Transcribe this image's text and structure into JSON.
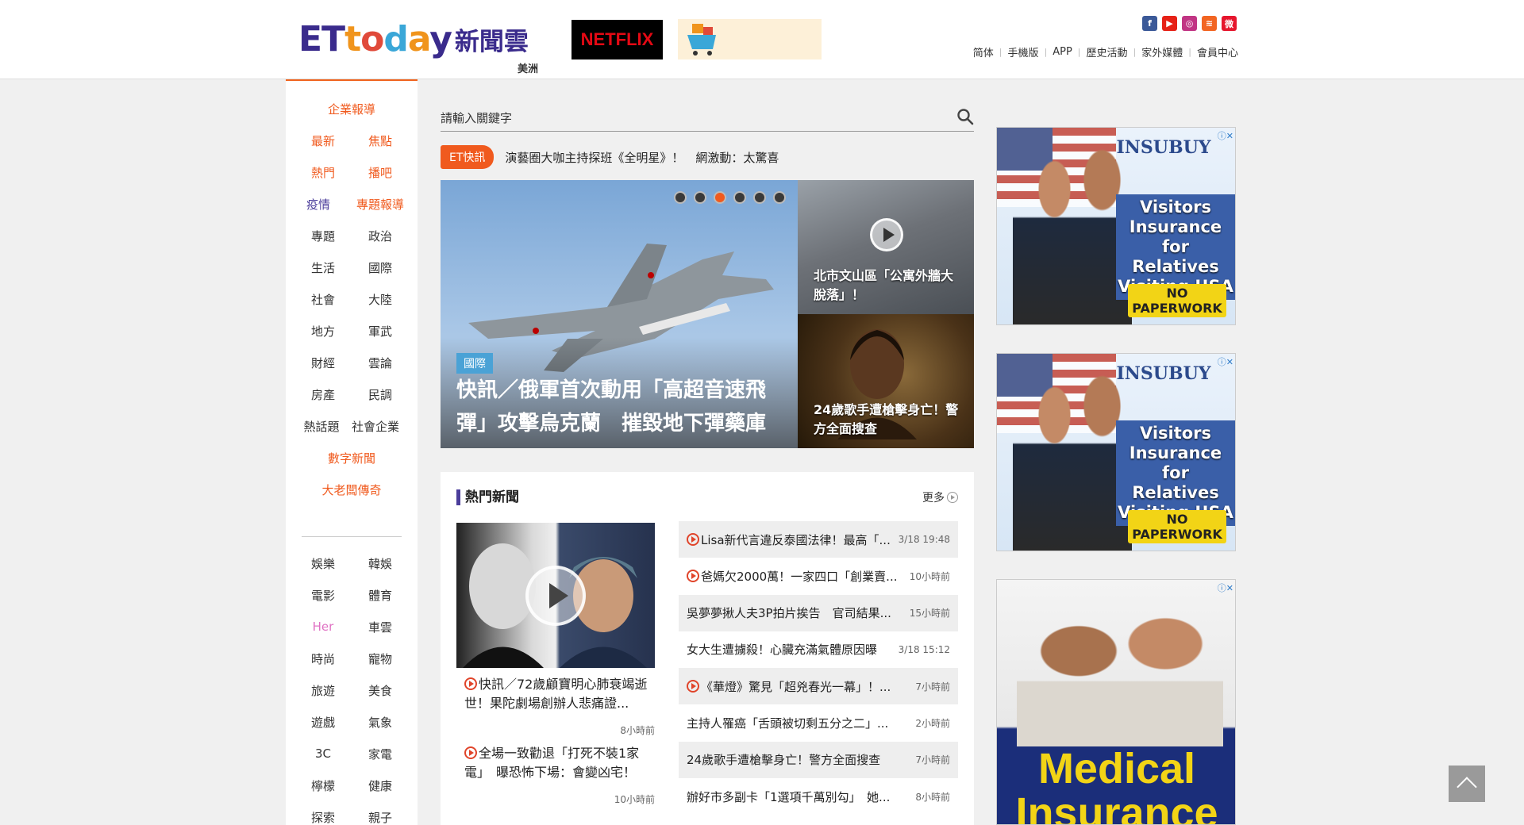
{
  "header": {
    "logo_et": [
      "ET",
      "t",
      "o",
      "d",
      "a",
      "y"
    ],
    "logo_cn": "新聞雲",
    "region": "美洲",
    "netflix_label": "NETFLIX",
    "topnav": [
      "简体",
      "手機版",
      "APP",
      "歷史活動",
      "家外媒體",
      "會員中心"
    ],
    "social_icons": [
      {
        "name": "facebook-icon",
        "glyph": "f",
        "color": "#3b5998"
      },
      {
        "name": "youtube-icon",
        "glyph": "▶",
        "color": "#e62117"
      },
      {
        "name": "instagram-icon",
        "glyph": "◎",
        "color": "#c13584"
      },
      {
        "name": "rss-icon",
        "glyph": "≋",
        "color": "#f26522"
      },
      {
        "name": "weibo-icon",
        "glyph": "微",
        "color": "#e6162d"
      }
    ]
  },
  "leftnav": {
    "rows": [
      {
        "items": [
          "企業報導"
        ],
        "style": "orange"
      },
      {
        "items": [
          "最新",
          "焦點"
        ],
        "style": "orange"
      },
      {
        "items": [
          "熱門",
          "播吧"
        ],
        "style": "orange"
      },
      {
        "items": [
          "疫情",
          "專題報導"
        ],
        "style": "purple-orange"
      },
      {
        "items": [
          "專題",
          "政治"
        ],
        "style": "plain"
      },
      {
        "items": [
          "生活",
          "國際"
        ],
        "style": "plain"
      },
      {
        "items": [
          "社會",
          "大陸"
        ],
        "style": "plain"
      },
      {
        "items": [
          "地方",
          "軍武"
        ],
        "style": "plain"
      },
      {
        "items": [
          "財經",
          "雲論"
        ],
        "style": "plain"
      },
      {
        "items": [
          "房產",
          "民調"
        ],
        "style": "plain"
      },
      {
        "items": [
          "熱話題",
          "社會企業"
        ],
        "style": "plain"
      },
      {
        "items": [
          "數字新聞"
        ],
        "style": "orange"
      },
      {
        "items": [
          "大老闆傳奇"
        ],
        "style": "orange"
      }
    ],
    "rows2": [
      {
        "items": [
          "娛樂",
          "韓娛"
        ],
        "style": "plain"
      },
      {
        "items": [
          "電影",
          "體育"
        ],
        "style": "plain"
      },
      {
        "items": [
          "Her",
          "車雲"
        ],
        "style": "pink-plain"
      },
      {
        "items": [
          "時尚",
          "寵物"
        ],
        "style": "plain"
      },
      {
        "items": [
          "旅遊",
          "美食"
        ],
        "style": "plain"
      },
      {
        "items": [
          "遊戲",
          "氣象"
        ],
        "style": "plain"
      },
      {
        "items": [
          "3C",
          "家電"
        ],
        "style": "plain"
      },
      {
        "items": [
          "檸檬",
          "健康"
        ],
        "style": "plain"
      },
      {
        "items": [
          "探索",
          "親子"
        ],
        "style": "plain"
      }
    ]
  },
  "search": {
    "placeholder": "請輸入關鍵字"
  },
  "ticker": {
    "tag": "ET快訊",
    "text": "演藝圈大咖主持探班《全明星》！　網激動：太驚喜"
  },
  "hero": {
    "category": "國際",
    "title": "快訊／俄軍首次動用「高超音速飛彈」攻擊烏克蘭　摧毀地下彈藥庫",
    "dots": 6,
    "active_dot": 2,
    "side1_title": "北市文山區「公寓外牆大脫落」！",
    "side2_title": "24歲歌手遭槍擊身亡！警方全面搜查"
  },
  "hot": {
    "heading": "熱門新聞",
    "more": "更多",
    "feature": [
      {
        "title": "快訊／72歲顧寶明心肺衰竭逝世！果陀劇場創辦人悲痛證...",
        "time": "8小時前"
      },
      {
        "title": "全場一致勸退「打死不裝1家電」　曝恐怖下場：會變凶宅！",
        "time": "10小時前"
      }
    ],
    "list": [
      {
        "title": "Lisa新代言違反泰國法律！最高「...",
        "time": "3/18 19:48",
        "video": true
      },
      {
        "title": "爸媽欠2000萬！一家四口「創業賣...",
        "time": "10小時前",
        "video": true
      },
      {
        "title": "吳夢夢揪人夫3P拍片挨告　官司結果...",
        "time": "15小時前",
        "video": false
      },
      {
        "title": "女大生遭擄殺！心臟充滿氣體原因曝",
        "time": "3/18 15:12",
        "video": false
      },
      {
        "title": "《華燈》驚見「超兇春光一幕」！...",
        "time": "7小時前",
        "video": true
      },
      {
        "title": "主持人罹癌「舌頭被切剩五分之二」...",
        "time": "2小時前",
        "video": false
      },
      {
        "title": "24歲歌手遭槍擊身亡！警方全面搜查",
        "time": "7小時前",
        "video": false
      },
      {
        "title": "辦好市多副卡「1選項千萬別勾」　她...",
        "time": "8小時前",
        "video": false
      }
    ]
  },
  "ads": [
    {
      "brand": "INSUBUY",
      "slogan": "Visitors Insurance for Relatives Visiting USA",
      "badge": "NO PAPERWORK"
    },
    {
      "brand": "INSUBUY",
      "slogan": "Visitors Insurance for Relatives Visiting USA",
      "badge": "NO PAPERWORK"
    },
    {
      "big": "Medical Insurance"
    }
  ]
}
